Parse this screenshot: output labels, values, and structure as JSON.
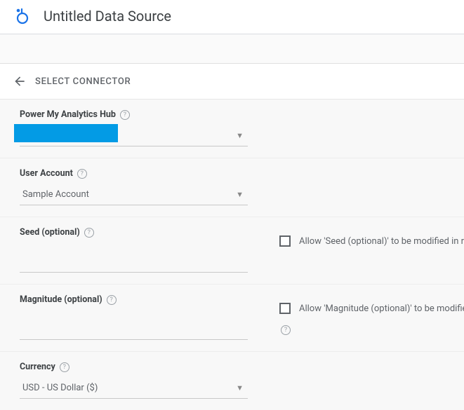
{
  "header": {
    "title": "Untitled Data Source"
  },
  "nav": {
    "label": "SELECT CONNECTOR"
  },
  "form": {
    "hub": {
      "label": "Power My Analytics Hub",
      "value": ""
    },
    "userAccount": {
      "label": "User Account",
      "value": "Sample Account"
    },
    "seed": {
      "label": "Seed (optional)",
      "value": "",
      "allowLabel": "Allow 'Seed (optional)' to be modified in re"
    },
    "magnitude": {
      "label": "Magnitude (optional)",
      "value": "",
      "allowLabel": "Allow 'Magnitude (optional)' to be modified"
    },
    "currency": {
      "label": "Currency",
      "value": "USD - US Dollar ($)"
    }
  }
}
